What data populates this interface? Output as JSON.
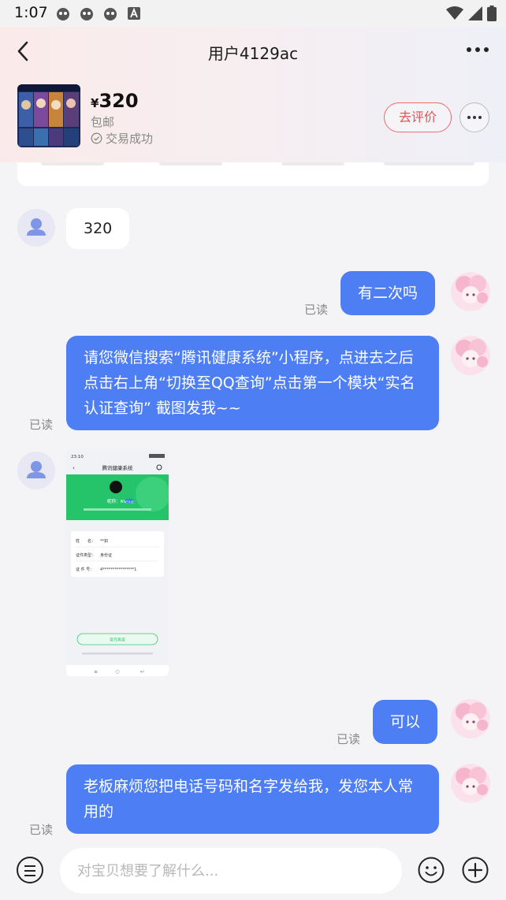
{
  "status_bar": {
    "time": "1:07"
  },
  "header": {
    "title": "用户4129ac"
  },
  "product": {
    "price_symbol": "¥",
    "price": "320",
    "shipping": "包邮",
    "trade_status": "交易成功",
    "review_label": "去评价"
  },
  "messages": [
    {
      "from": "other",
      "type": "text",
      "text": "320"
    },
    {
      "from": "self",
      "type": "text",
      "text": "有二次吗",
      "read": "已读"
    },
    {
      "from": "self",
      "type": "text",
      "text": "请您微信搜索“腾讯健康系统”小程序，点进去之后点击右上角“切换至QQ查询”点击第一个模块“实名认证查询” 截图发我~~",
      "read": "已读"
    },
    {
      "from": "other",
      "type": "image",
      "shot": {
        "time": "23:10",
        "title": "腾讯健康系统",
        "nickname": "昵称：NVC",
        "badge": "已认证",
        "name_label": "姓　　名：",
        "name_value": "**如",
        "id_type_label": "证件类型：",
        "id_type_value": "身份证",
        "id_no_label": "证 件 号：",
        "id_no_value": "4****************1",
        "query_btn": "查完再查"
      }
    },
    {
      "from": "self",
      "type": "text",
      "text": "可以",
      "read": "已读"
    },
    {
      "from": "self",
      "type": "text",
      "text": "老板麻烦您把电话号码和名字发给我，发您本人常用的",
      "read": "已读"
    }
  ],
  "input": {
    "placeholder": "对宝贝想要了解什么..."
  }
}
